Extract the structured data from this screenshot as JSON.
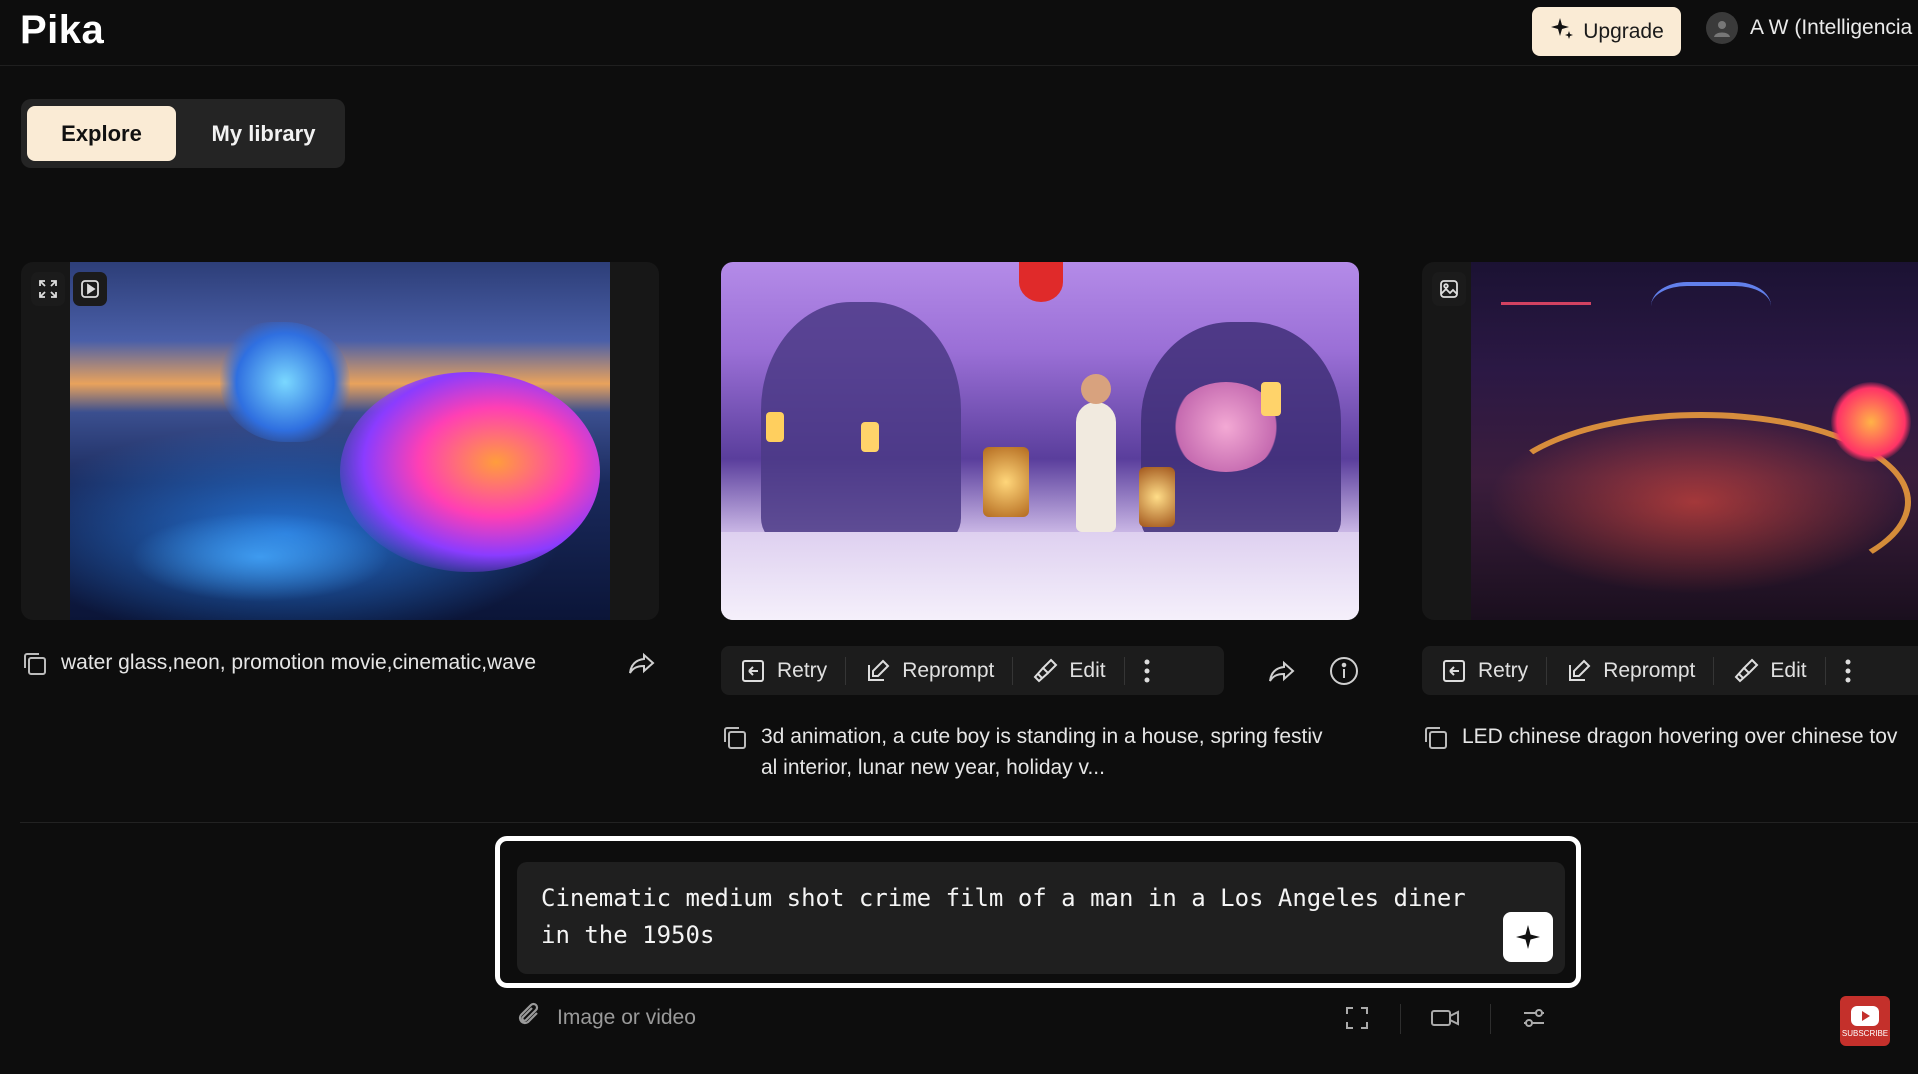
{
  "app": {
    "logo": "Pika"
  },
  "header": {
    "upgrade_label": "Upgrade",
    "user_name": "A W (Intelligencia",
    "accent_color": "#faebd5"
  },
  "tabs": [
    {
      "label": "Explore",
      "active": true
    },
    {
      "label": "My library",
      "active": false
    }
  ],
  "cards": [
    {
      "caption": "water glass,neon, promotion movie,cinematic,wave",
      "media_tools": [
        "expand-icon",
        "play-icon"
      ]
    },
    {
      "actions": [
        "Retry",
        "Reprompt",
        "Edit"
      ],
      "caption_line1": "3d animation, a cute boy is standing in a house, spring festiv",
      "caption_line2": "al interior, lunar new year, holiday v..."
    },
    {
      "actions": [
        "Retry",
        "Reprompt",
        "Edit"
      ],
      "caption": "LED chinese dragon hovering over chinese tov",
      "media_tools": [
        "image-icon"
      ]
    }
  ],
  "prompt": {
    "line1": "Cinematic medium shot crime film of a man in a Los Angeles diner",
    "line2": "in the 1950s"
  },
  "toolbar": {
    "attach_label": "Image or video",
    "icons": [
      "frame-icon",
      "video-camera-icon",
      "settings-sliders-icon"
    ]
  },
  "youtube": {
    "label": "SUBSCRIBE"
  }
}
